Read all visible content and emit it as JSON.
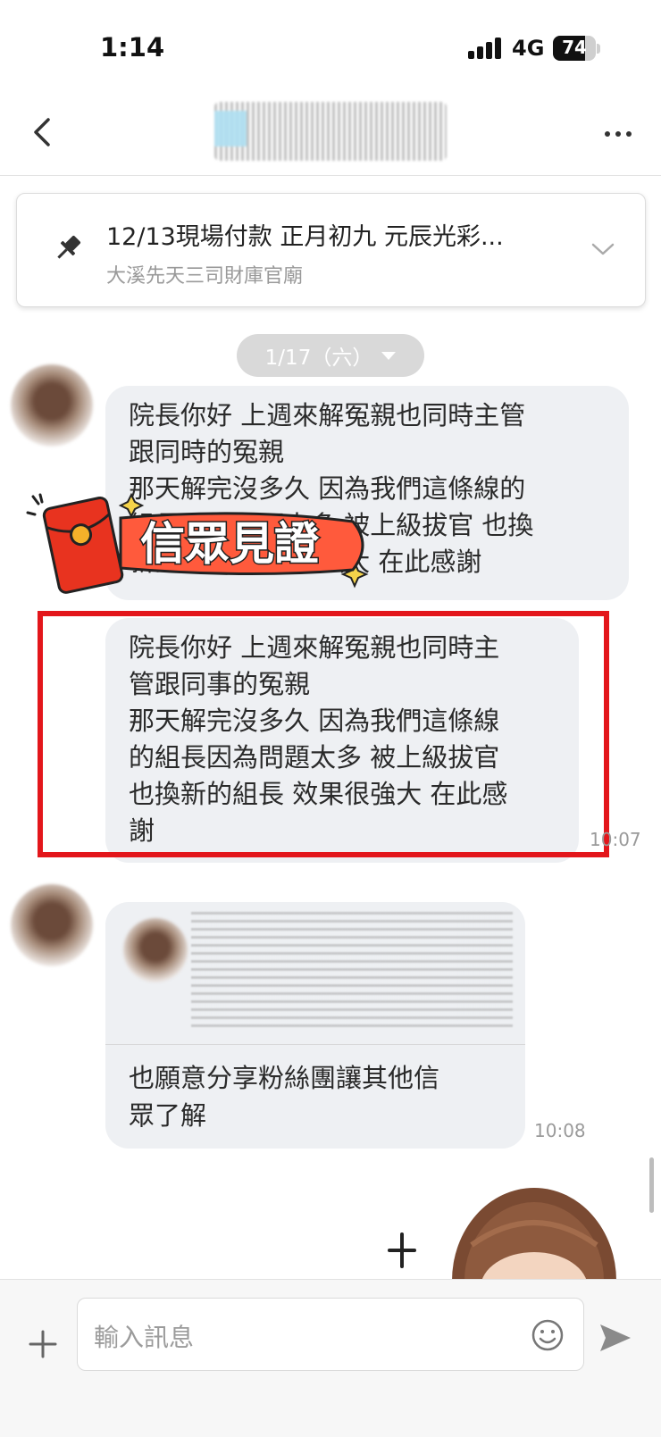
{
  "status_bar": {
    "time": "1:14",
    "network": "4G",
    "battery": "74",
    "battery_level": 0.74
  },
  "header": {
    "back_icon": "chevron-left-icon",
    "more_icon": "more-dots-icon"
  },
  "pinned": {
    "title": "12/13現場付款 正月初九 元辰光彩...",
    "subtitle": "大溪先天三司財庫官廟",
    "icon": "pin-icon"
  },
  "date_chip": {
    "label": "1/17（六）"
  },
  "messages": [
    {
      "text": "院長你好 上週來解冤親也同時主管\n跟同時的冤親\n那天解完沒多久 因為我們這條線的\n組長因為問題太多 被上級拔官 也換\n新的組長 效果很強大 在此感謝"
    },
    {
      "text": "院長你好 上週來解冤親也同時主\n管跟同事的冤親\n那天解完沒多久 因為我們這條線\n的組長因為問題太多 被上級拔官\n也換新的組長 效果很強大 在此感\n謝",
      "time": "10:07"
    },
    {
      "reply_text": "也願意分享粉絲團讓其他信\n眾了解",
      "time": "10:08"
    }
  ],
  "sticker": {
    "text": "信眾見證",
    "colors": {
      "banner": "#ff5a3c",
      "envelope": "#e8331f",
      "coin": "#f5b12a"
    }
  },
  "highlight_color": "#e3161b",
  "input": {
    "placeholder": "輸入訊息",
    "plus_icon": "plus-icon",
    "emoji_icon": "smiley-icon",
    "send_icon": "send-icon"
  }
}
